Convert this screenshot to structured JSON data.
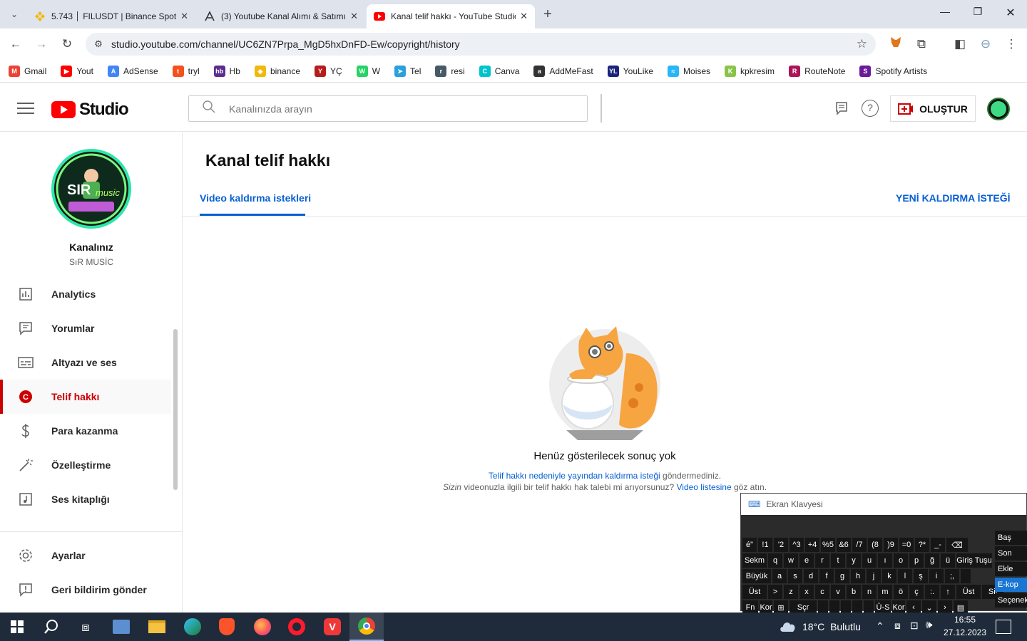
{
  "browser": {
    "tabs": [
      {
        "title": "5.743 │ FILUSDT | Binance Spot",
        "icon": "binance-icon",
        "color": "#f0b90b"
      },
      {
        "title": "(3) Youtube Kanal Alımı & Satımı",
        "icon": "forum-icon",
        "color": "#333333"
      },
      {
        "title": "Kanal telif hakkı - YouTube Studio",
        "icon": "youtube-icon",
        "color": "#ff0000"
      }
    ],
    "url": "studio.youtube.com/channel/UC6ZN7Prpa_MgD5hxDnFD-Ew/copyright/history",
    "bookmarks": [
      {
        "label": "Gmail",
        "icon": "gmail-icon",
        "color": "#ea4335",
        "glyph": "M"
      },
      {
        "label": "Yout",
        "icon": "youtube-icon",
        "color": "#ff0000",
        "glyph": "▶"
      },
      {
        "label": "AdSense",
        "icon": "adsense-icon",
        "color": "#4285f4",
        "glyph": "A"
      },
      {
        "label": "tryl",
        "icon": "tryl-icon",
        "color": "#f4511e",
        "glyph": "t"
      },
      {
        "label": "Hb",
        "icon": "hepsiburada-icon",
        "color": "#5c2d91",
        "glyph": "hb"
      },
      {
        "label": "binance",
        "icon": "binance-icon",
        "color": "#f0b90b",
        "glyph": "◆"
      },
      {
        "label": "YÇ",
        "icon": "yc-icon",
        "color": "#b71c1c",
        "glyph": "Y"
      },
      {
        "label": "W",
        "icon": "whatsapp-icon",
        "color": "#25d366",
        "glyph": "W"
      },
      {
        "label": "Tel",
        "icon": "telegram-icon",
        "color": "#2aa1da",
        "glyph": "➤"
      },
      {
        "label": "resi",
        "icon": "resi-icon",
        "color": "#455a64",
        "glyph": "r"
      },
      {
        "label": "Canva",
        "icon": "canva-icon",
        "color": "#00c4cc",
        "glyph": "C"
      },
      {
        "label": "AddMeFast",
        "icon": "addmefast-icon",
        "color": "#333333",
        "glyph": "a"
      },
      {
        "label": "YouLike",
        "icon": "youlike-icon",
        "color": "#1a237e",
        "glyph": "YL"
      },
      {
        "label": "Moises",
        "icon": "moises-icon",
        "color": "#29b6f6",
        "glyph": "≈"
      },
      {
        "label": "kpkresim",
        "icon": "kpkresim-icon",
        "color": "#8bc34a",
        "glyph": "K"
      },
      {
        "label": "RouteNote",
        "icon": "routenote-icon",
        "color": "#ad1457",
        "glyph": "R"
      },
      {
        "label": "Spotify Artists",
        "icon": "spotify-icon",
        "color": "#6a1b9a",
        "glyph": "S"
      }
    ]
  },
  "studio": {
    "logo_text": "Studio",
    "search_placeholder": "Kanalınızda arayın",
    "create_label": "OLUŞTUR",
    "channel_heading": "Kanalınız",
    "channel_name": "SıR MUSİC",
    "nav": [
      {
        "label": "Analytics",
        "icon": "analytics-icon",
        "selected": false
      },
      {
        "label": "Yorumlar",
        "icon": "comments-icon",
        "selected": false
      },
      {
        "label": "Altyazı ve ses",
        "icon": "subtitles-icon",
        "selected": false
      },
      {
        "label": "Telif hakkı",
        "icon": "copyright-icon",
        "selected": true
      },
      {
        "label": "Para kazanma",
        "icon": "dollar-icon",
        "selected": false
      },
      {
        "label": "Özelleştirme",
        "icon": "magic-wand-icon",
        "selected": false
      },
      {
        "label": "Ses kitaplığı",
        "icon": "audio-library-icon",
        "selected": false
      }
    ],
    "settings_label": "Ayarlar",
    "feedback_label": "Geri bildirim gönder",
    "page_title": "Kanal telif hakkı",
    "tab_label": "Video kaldırma istekleri",
    "new_request_label": "YENİ KALDIRMA İSTEĞİ",
    "empty_title": "Henüz gösterilecek sonuç yok",
    "empty_line1_link": "Telif hakkı nedeniyle yayından kaldırma isteği",
    "empty_line1_rest": "göndermediniz.",
    "empty_line2_em": "Sizin",
    "empty_line2_mid": "videonuzla ilgili bir telif hakkı hak talebi mi arıyorsunuz?",
    "empty_line2_link": "Video listesine",
    "empty_line2_end": "göz atın.",
    "accent": "#065fd4",
    "brand": "#ff0000"
  },
  "keyboard": {
    "title": "Ekran Klavyesi",
    "rows": [
      [
        "é\"",
        "!1",
        "'2",
        "^3",
        "+4",
        "%5",
        "&6",
        "/7",
        "(8",
        ")9",
        "=0",
        "?*",
        "_-",
        "⌫"
      ],
      [
        "Sekm",
        "q",
        "w",
        "e",
        "r",
        "t",
        "y",
        "u",
        "ı",
        "o",
        "p",
        "ğ",
        "ü",
        "Giriş Tuşu"
      ],
      [
        "Büyük",
        "a",
        "s",
        "d",
        "f",
        "g",
        "h",
        "j",
        "k",
        "l",
        "ş",
        "i",
        ";,",
        ""
      ],
      [
        "Üst",
        ">",
        "z",
        "x",
        "c",
        "v",
        "b",
        "n",
        "m",
        "ö",
        "ç",
        ":.",
        "↑",
        "Üst",
        "Sil"
      ],
      [
        "Fn",
        "Kor",
        "⊞",
        "Sçr",
        "",
        "",
        "",
        "",
        "",
        "Ü-S",
        "Kor",
        "‹",
        "⌄",
        "›",
        "▤"
      ]
    ],
    "side_keys": [
      "Baş",
      "Son",
      "Ekle",
      "E-kop",
      "Seçenek"
    ]
  },
  "taskbar": {
    "weather_temp": "18°C",
    "weather_text": "Bulutlu",
    "time": "16:55",
    "date": "27.12.2023"
  }
}
